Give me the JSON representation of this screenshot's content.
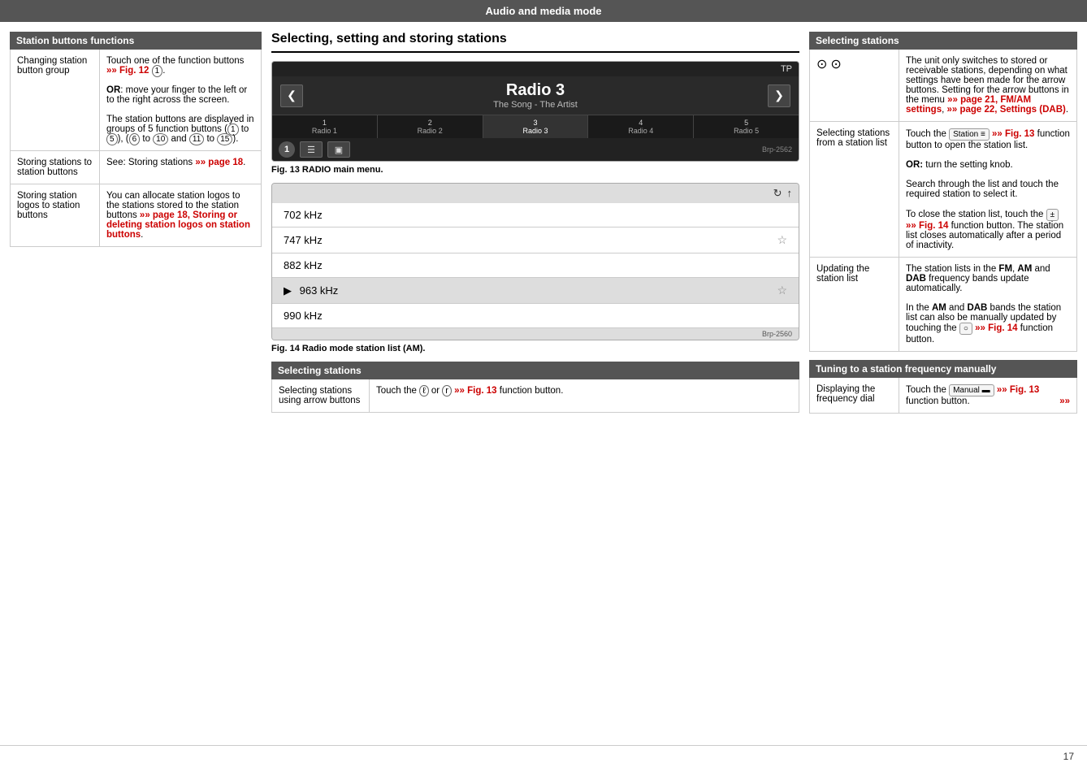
{
  "header": {
    "title": "Audio and media mode"
  },
  "left": {
    "section_title": "Station buttons functions",
    "rows": [
      {
        "left": "Changing station button group",
        "right_parts": [
          {
            "text": "Touch one of the function buttons ",
            "type": "normal"
          },
          {
            "text": "»» Fig. 12 ",
            "type": "link"
          },
          {
            "text": "①",
            "type": "circled"
          },
          {
            "text": ".",
            "type": "normal"
          },
          {
            "text": "\nOR",
            "type": "bold"
          },
          {
            "text": ": move your finger to the left or to the right across the screen.",
            "type": "normal"
          },
          {
            "text": "\nThe station buttons are displayed in groups of 5 function buttons (",
            "type": "normal"
          },
          {
            "text": "①",
            "type": "circled"
          },
          {
            "text": " to ",
            "type": "normal"
          },
          {
            "text": "⑤",
            "type": "circled"
          },
          {
            "text": "), (",
            "type": "normal"
          },
          {
            "text": "⑥",
            "type": "circled"
          },
          {
            "text": " to ",
            "type": "normal"
          },
          {
            "text": "⑩",
            "type": "circled"
          },
          {
            "text": " and ",
            "type": "normal"
          },
          {
            "text": "⑪",
            "type": "circled"
          },
          {
            "text": " to ",
            "type": "normal"
          },
          {
            "text": "⑮",
            "type": "circled"
          },
          {
            "text": ").",
            "type": "normal"
          }
        ]
      },
      {
        "left": "Storing stations to station buttons",
        "right_plain": "See: Storing stations »» page 18."
      },
      {
        "left": "Storing station logos to station buttons",
        "right_link": "You can allocate station logos to the stations stored to the station buttons »» page 18, Storing or deleting station logos on station buttons."
      }
    ]
  },
  "middle": {
    "title": "Selecting, setting and storing stations",
    "fig13_caption": "Fig. 13",
    "fig13_label": "RADIO main menu.",
    "fig14_caption": "Fig. 14",
    "fig14_label": "Radio mode station list (AM).",
    "radio_ui": {
      "tp_label": "TP",
      "station_name": "Radio 3",
      "artist": "The Song - The Artist",
      "stations": [
        {
          "num": "1",
          "name": "Radio 1",
          "active": false
        },
        {
          "num": "2",
          "name": "Radio 2",
          "active": false
        },
        {
          "num": "3",
          "name": "Radio 3",
          "active": true
        },
        {
          "num": "4",
          "name": "Radio 4",
          "active": false
        },
        {
          "num": "5",
          "name": "Radio 5",
          "active": false
        }
      ],
      "brp_code1": "Brp-2562"
    },
    "station_list": {
      "items": [
        {
          "freq": "702 kHz",
          "star": false,
          "play": false,
          "active": false
        },
        {
          "freq": "747 kHz",
          "star": true,
          "play": false,
          "active": false
        },
        {
          "freq": "882 kHz",
          "star": false,
          "play": false,
          "active": false
        },
        {
          "freq": "963 kHz",
          "star": true,
          "play": true,
          "active": true
        },
        {
          "freq": "990 kHz",
          "star": false,
          "play": false,
          "active": false
        }
      ],
      "brp_code2": "Brp-2560"
    },
    "sel_stations_title": "Selecting stations",
    "sel_rows": [
      {
        "left": "Selecting stations using arrow buttons",
        "right": "Touch the ⓒ or ⓓ »» Fig. 13 function button."
      }
    ]
  },
  "right": {
    "sections": [
      {
        "title": "Selecting stations",
        "rows": [
          {
            "left": "⓪⓪",
            "right": "The unit only switches to stored or receivable stations, depending on what settings have been made for the arrow buttons. Setting for the arrow buttons in the menu »» page 21, FM/AM settings, »» page 22, Settings (DAB)."
          },
          {
            "left": "Selecting stations from a station list",
            "right_parts": [
              "Touch the [Station ≡] »» Fig. 13 function button to open the station list.",
              "OR: turn the setting knob.",
              "Search through the list and touch the required station to select it.",
              "To close the station list, touch the [±] »» Fig. 14 function button. The station list closes automatically after a period of inactivity."
            ]
          },
          {
            "left": "Updating the station list",
            "right_parts": [
              "The station lists in the FM, AM and DAB frequency bands update automatically.",
              "In the AM and DAB bands the station list can also be manually updated by touching the [○] »» Fig. 14 function button."
            ]
          }
        ]
      },
      {
        "title": "Tuning to a station frequency manually",
        "rows": [
          {
            "left": "Displaying the frequency dial",
            "right": "Touch the [Manual ▬] »» Fig. 13 function button."
          }
        ]
      }
    ]
  },
  "footer": {
    "page_number": "17",
    "arrow": "»»"
  }
}
